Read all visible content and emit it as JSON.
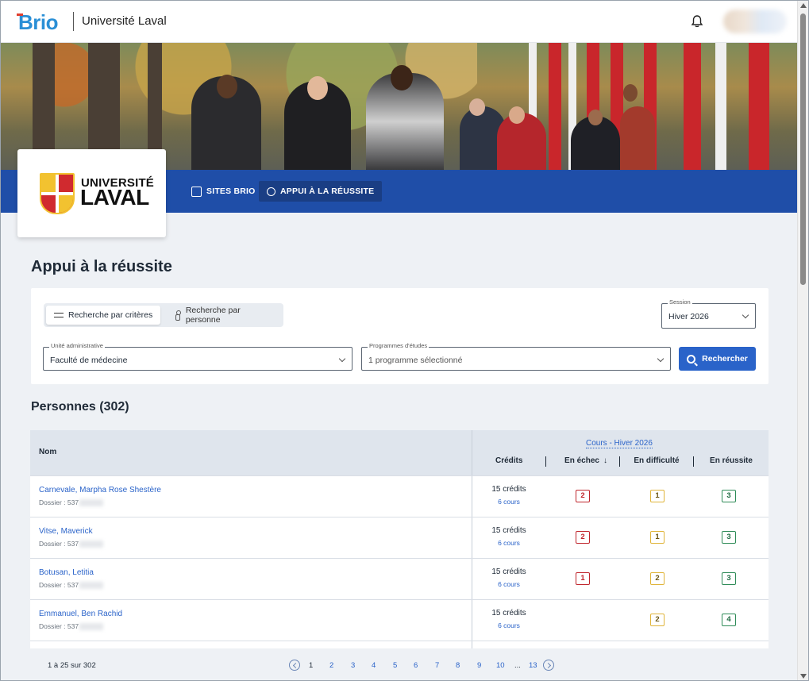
{
  "topbar": {
    "brand": "Brio",
    "institution": "Université Laval"
  },
  "nav": {
    "sites_brio": "SITES BRIO",
    "appui": "APPUI À LA RÉUSSITE"
  },
  "logo": {
    "line1": "UNIVERSITÉ",
    "line2": "LAVAL"
  },
  "page": {
    "title": "Appui à la réussite"
  },
  "search": {
    "tab_criteria": "Recherche par critères",
    "tab_person": "Recherche par personne",
    "session_label": "Session",
    "session_value": "Hiver 2026",
    "unit_label": "Unité administrative",
    "unit_value": "Faculté de médecine",
    "programs_label": "Programmes d'études",
    "programs_value": "1 programme sélectionné",
    "search_button": "Rechercher"
  },
  "persons": {
    "title": "Personnes (302)",
    "columns": {
      "name": "Nom",
      "cours_group": "Cours - Hiver 2026",
      "credits": "Crédits",
      "echec": "En échec",
      "difficulte": "En difficulté",
      "reussite": "En réussite",
      "sort_icon": "↓"
    },
    "rows": [
      {
        "name": "Carnevale, Marpha Rose Shestère",
        "dossier": "Dossier : 537",
        "credits": "15 crédits",
        "cours": "6 cours",
        "echec": "2",
        "difficulte": "1",
        "reussite": "3"
      },
      {
        "name": "Vitse, Maverick",
        "dossier": "Dossier : 537",
        "credits": "15 crédits",
        "cours": "6 cours",
        "echec": "2",
        "difficulte": "1",
        "reussite": "3"
      },
      {
        "name": "Botusan, Letitia",
        "dossier": "Dossier : 537",
        "credits": "15 crédits",
        "cours": "6 cours",
        "echec": "1",
        "difficulte": "2",
        "reussite": "3"
      },
      {
        "name": "Emmanuel, Ben Rachid",
        "dossier": "Dossier : 537",
        "credits": "15 crédits",
        "cours": "6 cours",
        "echec": "",
        "difficulte": "2",
        "reussite": "4"
      }
    ]
  },
  "pagination": {
    "range": "1 à 25 sur 302",
    "pages": [
      "1",
      "2",
      "3",
      "4",
      "5",
      "6",
      "7",
      "8",
      "9",
      "10"
    ],
    "ellipsis": "...",
    "last": "13"
  },
  "colors": {
    "primary_blue": "#1f4ea8",
    "link_blue": "#2a63c9",
    "fail_red": "#c0262d",
    "warn_yellow": "#e0b43a",
    "success_green": "#2e8b57"
  }
}
